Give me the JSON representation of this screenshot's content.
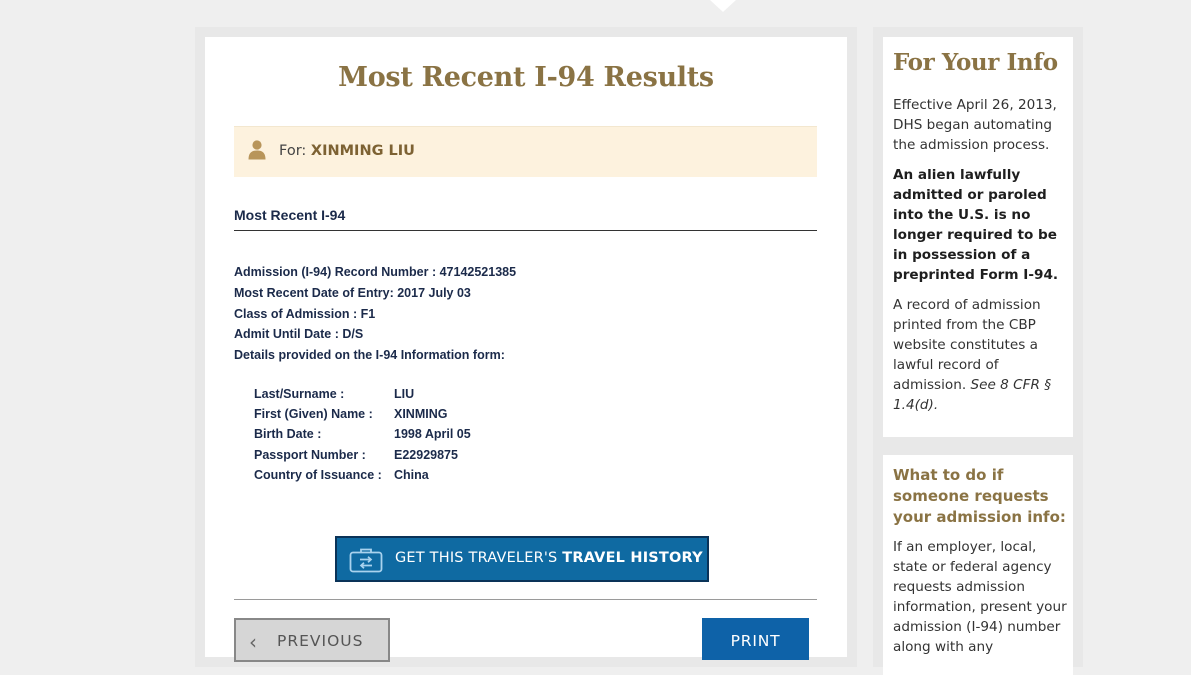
{
  "page": {
    "title": "Most Recent I-94 Results"
  },
  "traveler": {
    "for_label": "For:",
    "name": "XINMING LIU"
  },
  "section": {
    "title": "Most Recent I-94"
  },
  "record": {
    "lines": [
      "Admission (I-94) Record Number : 47142521385",
      "Most Recent Date of Entry: 2017 July 03",
      "Class of Admission : F1",
      "Admit Until Date : D/S",
      "Details provided on the I-94 Information form:"
    ]
  },
  "form_info": {
    "rows": [
      {
        "label": "Last/Surname :",
        "value": "LIU"
      },
      {
        "label": "First (Given) Name :",
        "value": "XINMING"
      },
      {
        "label": "Birth Date :",
        "value": "1998 April 05"
      },
      {
        "label": "Passport Number :",
        "value": "E22929875"
      },
      {
        "label": "Country of Issuance :",
        "value": "China"
      }
    ]
  },
  "buttons": {
    "history_prefix": "GET THIS TRAVELER'S ",
    "history_bold": "TRAVEL HISTORY",
    "previous": "PREVIOUS",
    "previous_chevron": "‹",
    "print": "PRINT"
  },
  "sidebar": {
    "title": "For Your Info",
    "para1": "Effective April 26, 2013, DHS began automating the admission process.",
    "para2": "An alien lawfully admitted or paroled into the U.S. is no longer required to be in possession of a preprinted Form I-94.",
    "para3_text": "A record of admission printed from the CBP website constitutes a lawful record of admission. ",
    "para3_cite": "See 8 CFR § 1.4(d).",
    "heading2": "What to do if someone requests your admission info:",
    "para4": "If an employer, local, state or federal agency requests admission information, present your admission (I-94) number along with any"
  },
  "colors": {
    "accent_gold": "#8a7344",
    "banner_bg": "#fdf2de",
    "button_blue": "#0f6aa2",
    "text_navy": "#1b2a4a"
  },
  "icons": {
    "user": "user-icon",
    "history": "travel-history-icon",
    "chevron": "chevron-left-icon"
  }
}
